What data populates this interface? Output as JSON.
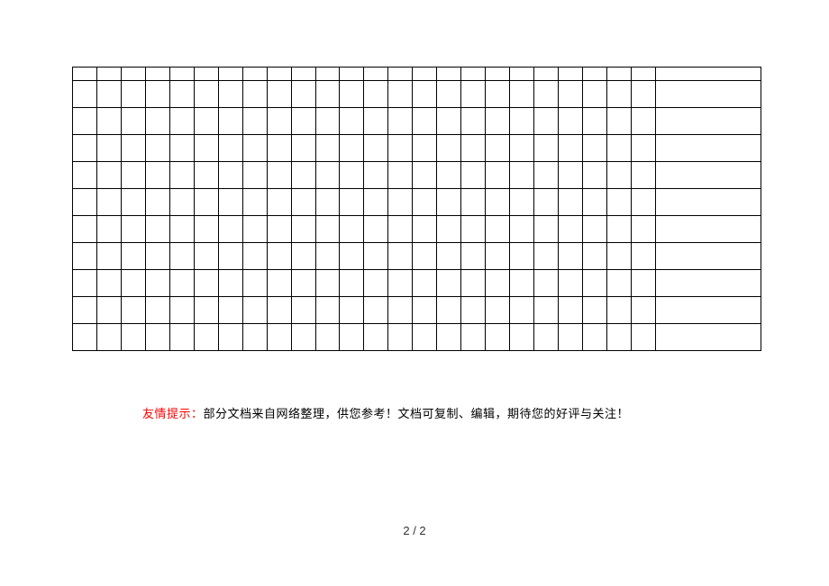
{
  "table": {
    "rows": 11,
    "narrow_cols": 24,
    "wide_cols": 1,
    "first_row_short": true
  },
  "notice": {
    "label": "友情提示：",
    "text": "部分文档来自网络整理，供您参考！文档可复制、编辑，期待您的好评与关注！"
  },
  "page": {
    "current": "2",
    "separator": " / ",
    "total": "2"
  }
}
